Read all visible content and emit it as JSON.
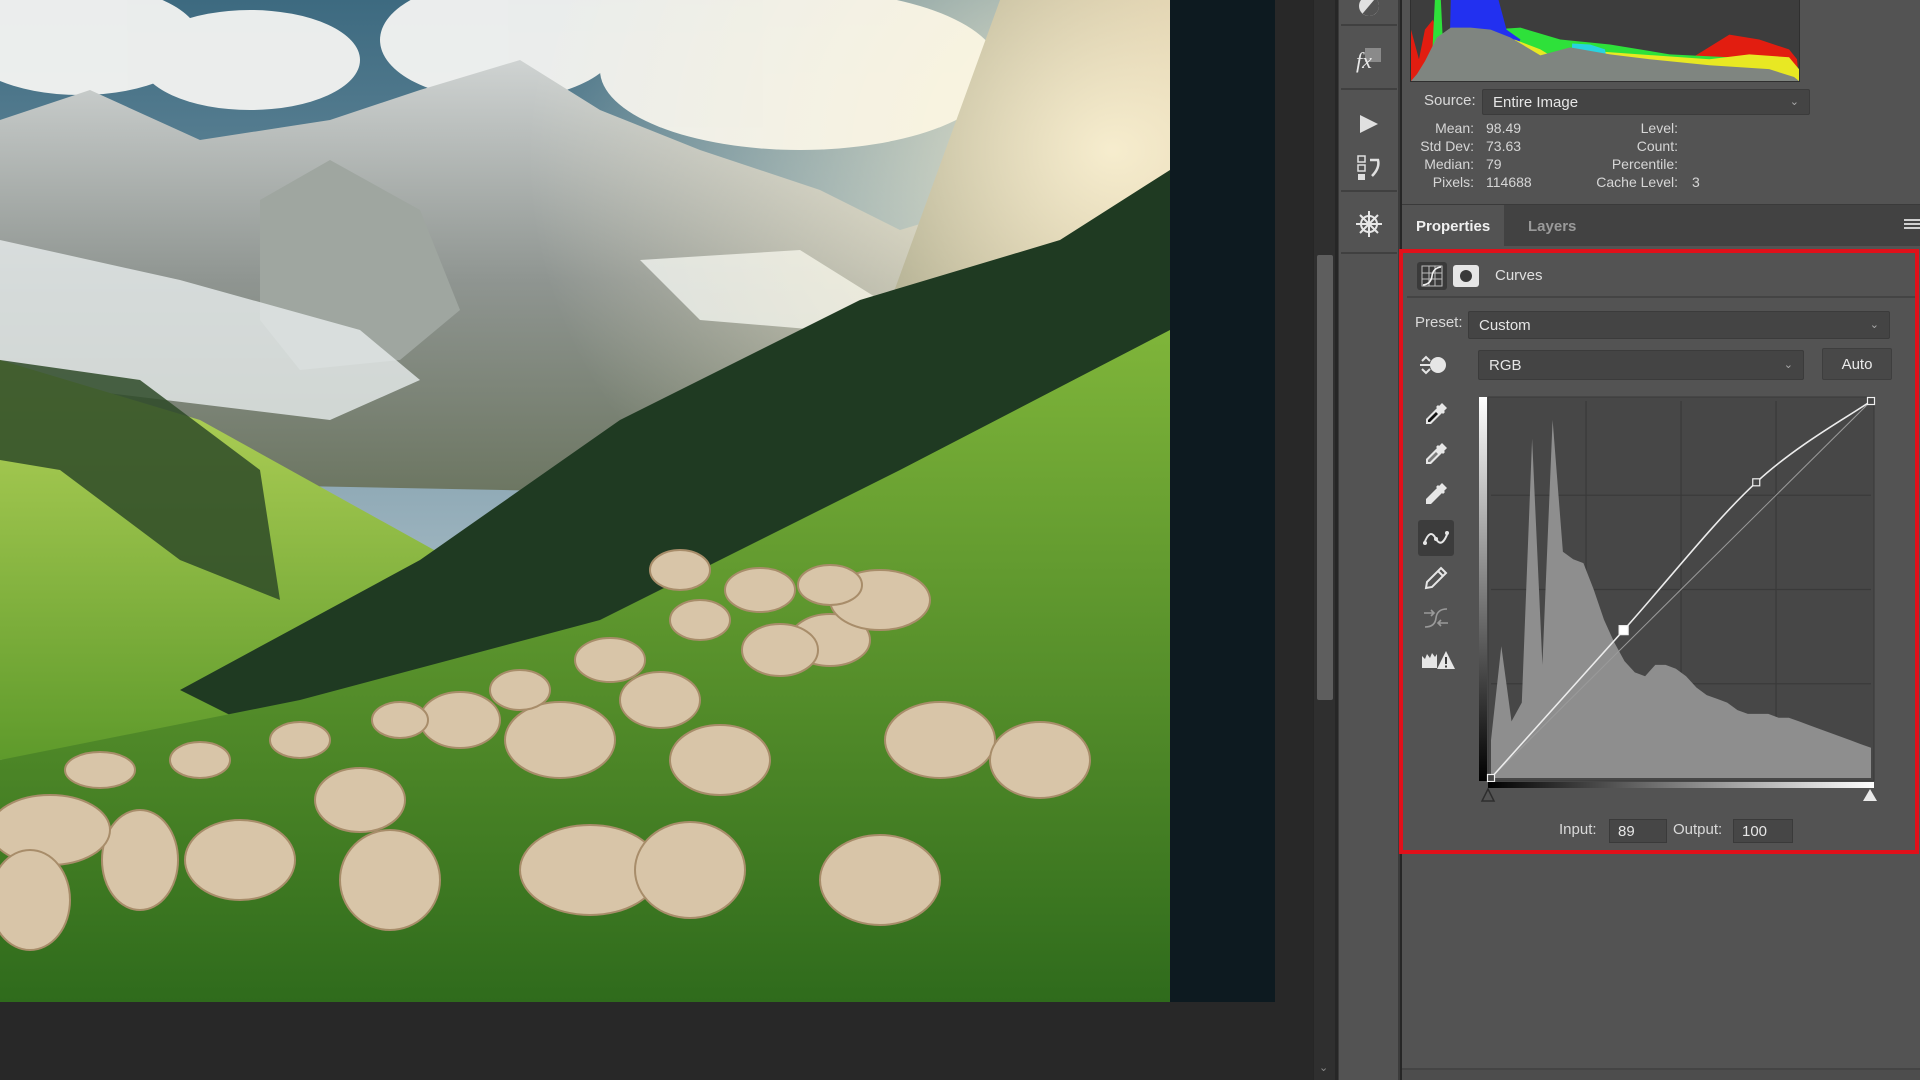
{
  "histogram_panel": {
    "source_label": "Source:",
    "source_value": "Entire Image",
    "stats": {
      "mean_label": "Mean:",
      "mean": "98.49",
      "std_dev_label": "Std Dev:",
      "std_dev": "73.63",
      "median_label": "Median:",
      "median": "79",
      "pixels_label": "Pixels:",
      "pixels": "114688",
      "level_label": "Level:",
      "level": "",
      "count_label": "Count:",
      "count": "",
      "percentile_label": "Percentile:",
      "percentile": "",
      "cache_level_label": "Cache Level:",
      "cache_level": "3"
    }
  },
  "dock": {
    "icons": [
      "adjustments-icon",
      "fx-styles-icon",
      "play-action-icon",
      "history-icon",
      "compass-icon"
    ]
  },
  "tabs": [
    {
      "label": "Properties",
      "active": true
    },
    {
      "label": "Layers",
      "active": false
    }
  ],
  "curves": {
    "title": "Curves",
    "preset_label": "Preset:",
    "preset_value": "Custom",
    "channel_value": "RGB",
    "auto_label": "Auto",
    "input_label": "Input:",
    "input_value": "89",
    "output_label": "Output:",
    "output_value": "100",
    "tools": [
      "black-point-eyedropper-icon",
      "gray-point-eyedropper-icon",
      "white-point-eyedropper-icon",
      "curve-points-icon",
      "pencil-draw-icon",
      "smooth-curve-icon",
      "clipping-warning-icon"
    ],
    "active_tool": "curve-points-icon",
    "points": [
      [
        0,
        0
      ],
      [
        89,
        100
      ],
      [
        178,
        200
      ],
      [
        255,
        255
      ]
    ]
  },
  "colors": {
    "highlight_border": "#e0101a",
    "panel_bg": "#535353",
    "workspace_bg": "#282828"
  }
}
